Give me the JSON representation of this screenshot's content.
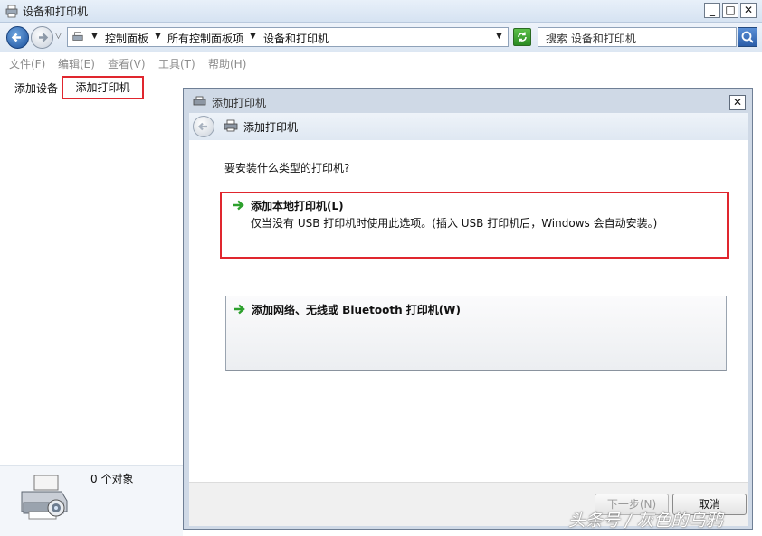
{
  "window": {
    "title": "设备和打印机"
  },
  "address_bar": {
    "breadcrumbs": [
      "控制面板",
      "所有控制面板项",
      "设备和打印机"
    ],
    "search_placeholder": "搜索 设备和打印机"
  },
  "menu": [
    "文件(F)",
    "编辑(E)",
    "查看(V)",
    "工具(T)",
    "帮助(H)"
  ],
  "command_bar": {
    "add_device": "添加设备",
    "add_printer": "添加打印机"
  },
  "details": {
    "object_count": "0 个对象"
  },
  "dialog": {
    "title": "添加打印机",
    "nav_title": "添加打印机",
    "question": "要安装什么类型的打印机?",
    "option_local": {
      "title": "添加本地打印机(L)",
      "description": "仅当没有 USB 打印机时使用此选项。(插入 USB 打印机后，Windows 会自动安装。)"
    },
    "option_network": {
      "title": "添加网络、无线或 Bluetooth 打印机(W)"
    },
    "next_button": "下一步(N)",
    "cancel_button": "取消"
  },
  "watermark": "头条号 / 灰色的乌鸦",
  "colors": {
    "highlight_red": "#e0262e",
    "arrow_green": "#2ca02c"
  },
  "icons": [
    "printer-folder-icon",
    "back-arrow-icon",
    "forward-arrow-icon",
    "refresh-icon",
    "search-icon",
    "printer-icon",
    "green-arrow-icon",
    "close-icon"
  ]
}
